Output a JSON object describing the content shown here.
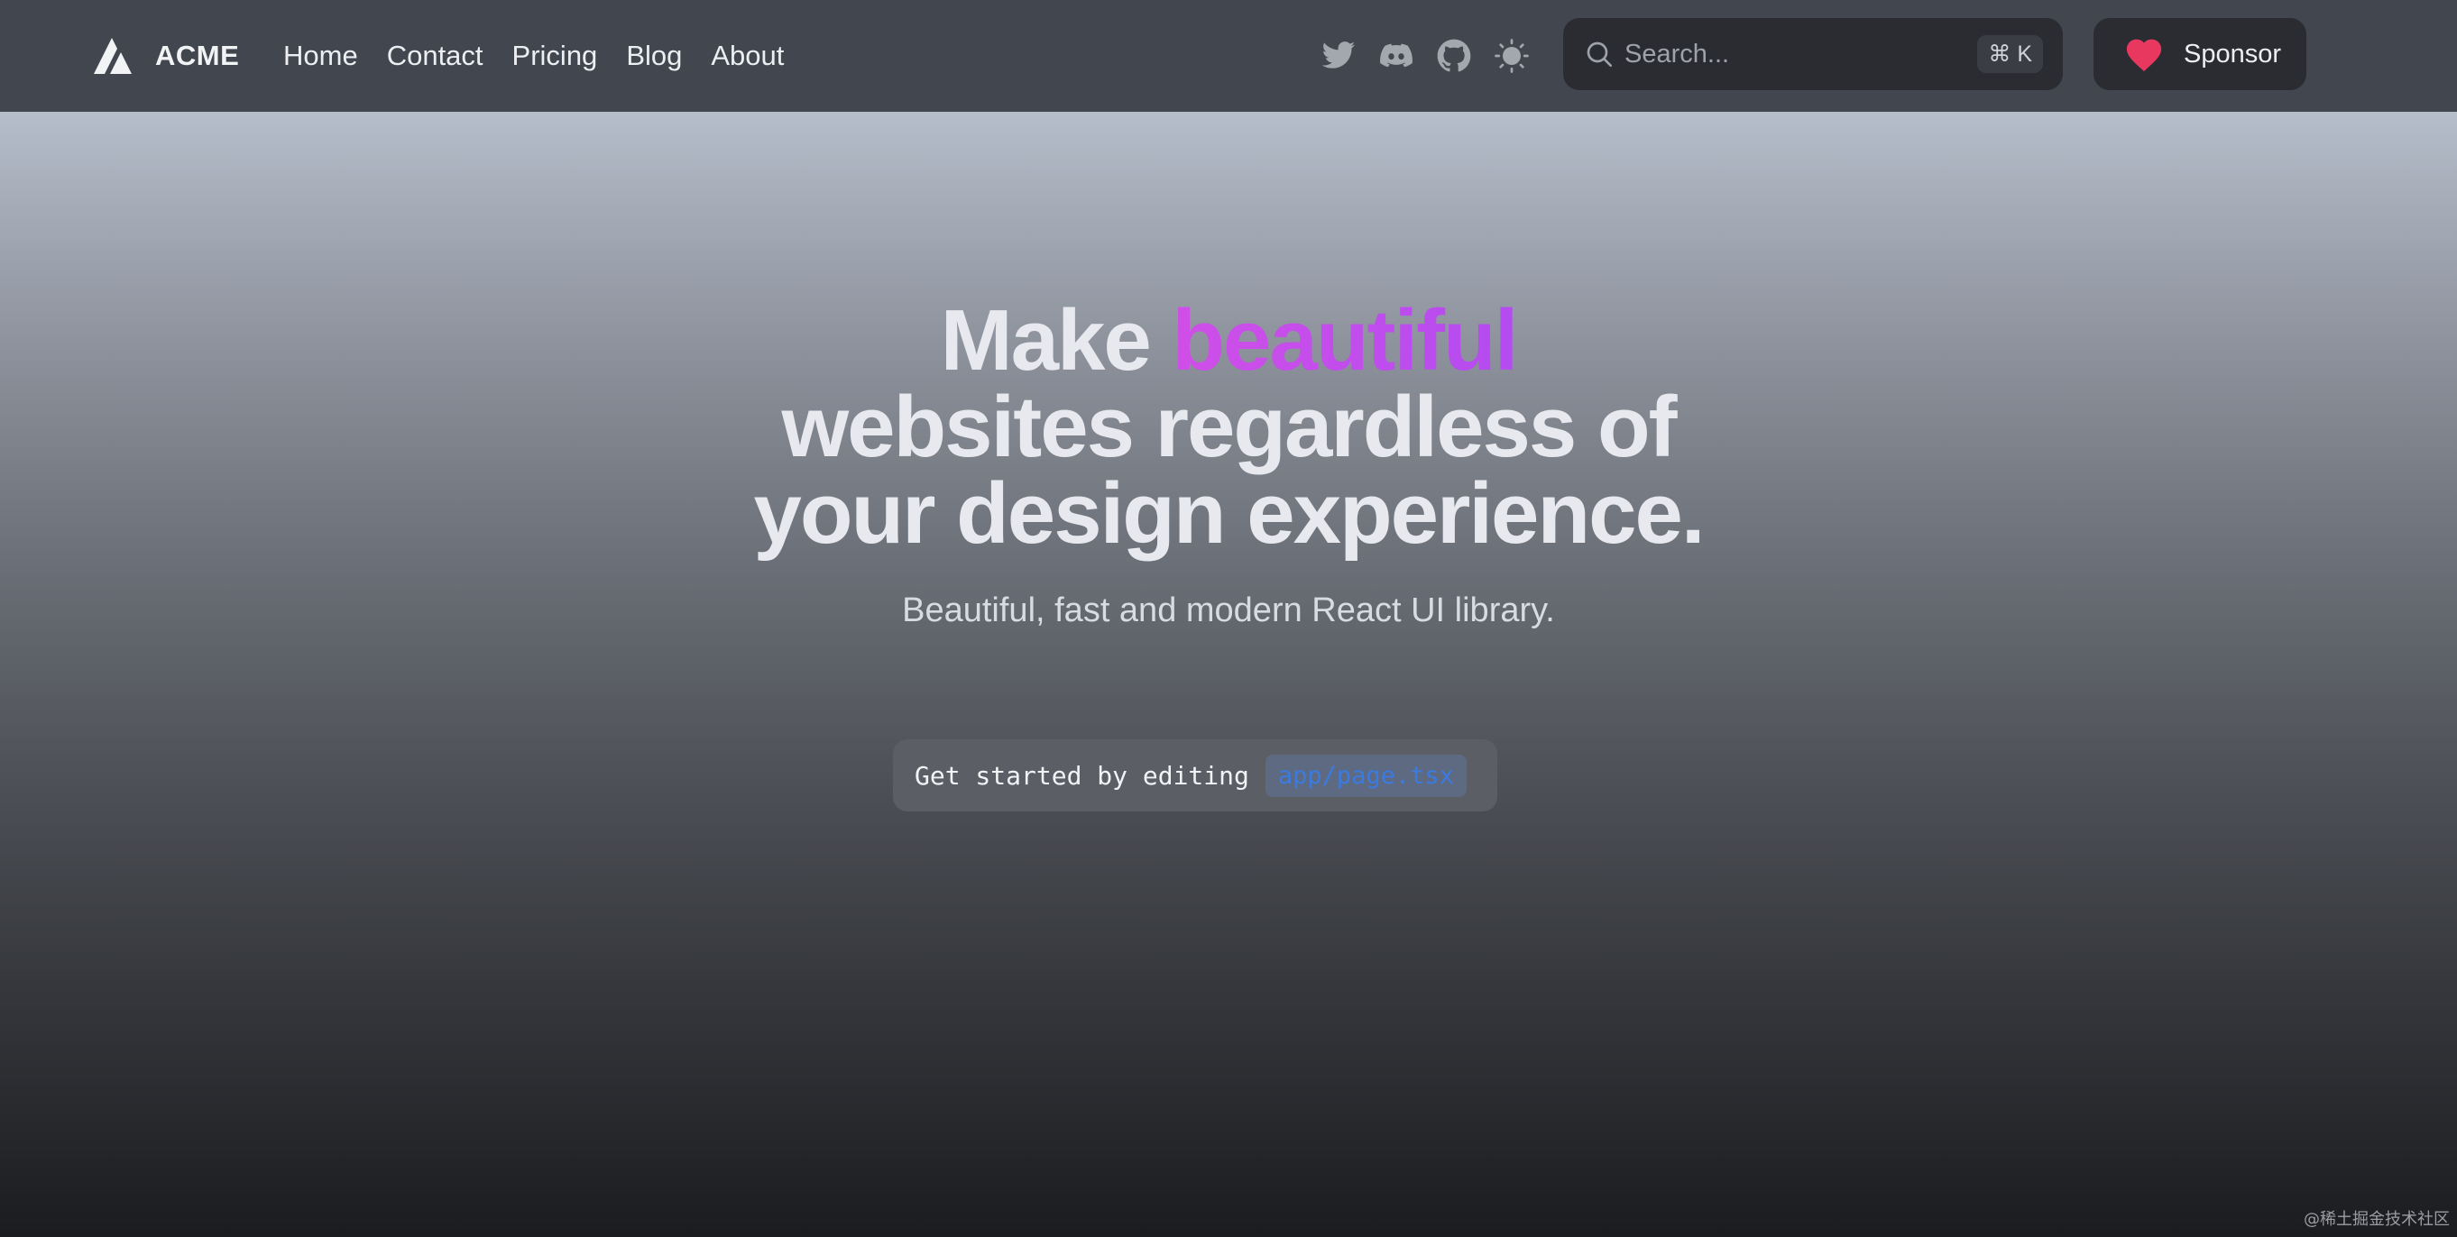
{
  "navbar": {
    "brand": "ACME",
    "links": [
      "Home",
      "Contact",
      "Pricing",
      "Blog",
      "About"
    ],
    "social_icons": [
      "twitter-icon",
      "discord-icon",
      "github-icon",
      "sun-icon"
    ],
    "search": {
      "placeholder": "Search...",
      "shortcut": "⌘ K"
    },
    "sponsor_label": "Sponsor"
  },
  "hero": {
    "title_prefix": "Make ",
    "title_accent": "beautiful",
    "title_line2": "websites regardless of",
    "title_line3": "your design experience.",
    "subtitle": "Beautiful, fast and modern React UI library.",
    "code_lead": "Get started by editing",
    "code_path": "app/page.tsx"
  },
  "watermark": "@稀土掘金技术社区",
  "colors": {
    "navbar_bg": "#41464f",
    "accent_purple": "#c04ef0",
    "heart_red": "#e8385f",
    "code_path_blue": "#3b7be0"
  }
}
